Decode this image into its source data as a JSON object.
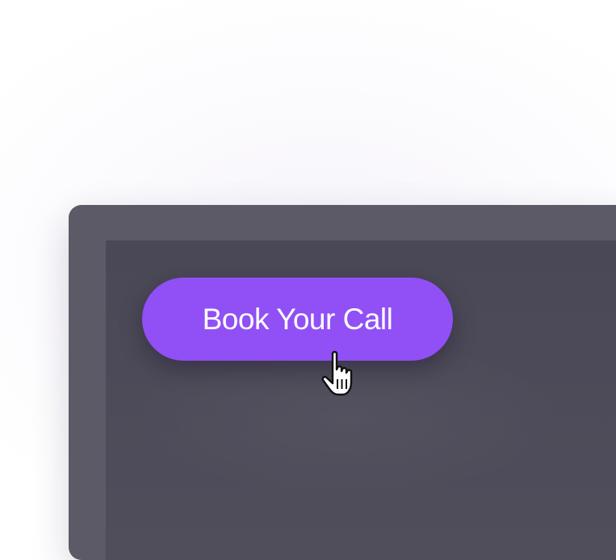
{
  "cta": {
    "label": "Book Your Call"
  },
  "cursor": {
    "icon": "hand-pointer-icon"
  },
  "colors": {
    "button": "#9050f5",
    "frame": "#5c5a66",
    "screen": "#4a4856"
  }
}
